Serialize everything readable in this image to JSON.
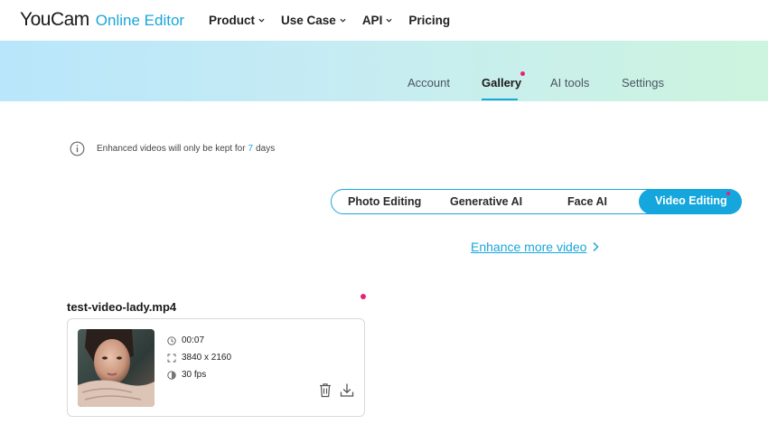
{
  "brand": {
    "name": "YouCam",
    "product": "Online Editor"
  },
  "nav": [
    {
      "label": "Product",
      "has_dropdown": true
    },
    {
      "label": "Use Case",
      "has_dropdown": true
    },
    {
      "label": "API",
      "has_dropdown": true
    },
    {
      "label": "Pricing",
      "has_dropdown": false
    }
  ],
  "account_tabs": [
    {
      "label": "Account",
      "active": false
    },
    {
      "label": "Gallery",
      "active": true,
      "badge": true
    },
    {
      "label": "AI tools",
      "active": false
    },
    {
      "label": "Settings",
      "active": false
    }
  ],
  "notice": {
    "prefix": "Enhanced videos will only be kept for",
    "days": "7",
    "suffix": "days"
  },
  "segments": [
    {
      "label": "Photo Editing",
      "active": false
    },
    {
      "label": "Generative AI",
      "active": false
    },
    {
      "label": "Face AI",
      "active": false
    },
    {
      "label": "Video Editing",
      "active": true,
      "badge": true
    }
  ],
  "enhance_link": "Enhance more video",
  "file": {
    "name": "test-video-lady.mp4",
    "duration": "00:07",
    "resolution": "3840 x 2160",
    "fps": "30 fps"
  },
  "colors": {
    "accent": "#1aa6d9",
    "badge": "#e6217a"
  }
}
